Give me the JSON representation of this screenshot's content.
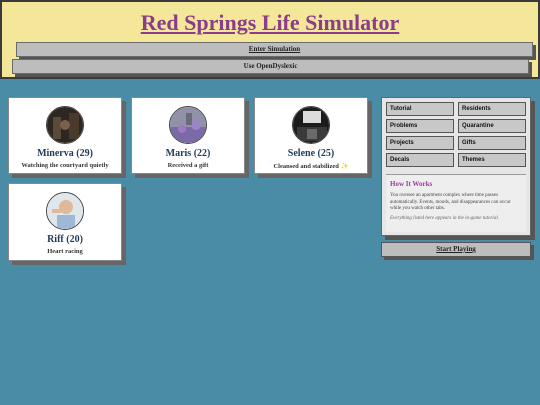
{
  "header": {
    "title": "Red Springs Life Simulator",
    "enter_button": "Enter Simulation",
    "dyslexic_button": "Use OpenDyslexic"
  },
  "residents": [
    {
      "name": "Minerva (29)",
      "status": "Watching the courtyard quietly",
      "avatar": "portrait-dark-room"
    },
    {
      "name": "Maris (22)",
      "status": "Received a gift",
      "avatar": "portrait-lavender-field"
    },
    {
      "name": "Selene (25)",
      "status": "Cleansed and stabilized ✨",
      "avatar": "portrait-dim-hall"
    },
    {
      "name": "Riff (20)",
      "status": "Heart racing",
      "avatar": "portrait-person-gesturing"
    }
  ],
  "panel": {
    "tabs": [
      "Tutorial",
      "Residents",
      "Problems",
      "Quarantine",
      "Projects",
      "Gifts",
      "Decals",
      "Themes"
    ],
    "how_title": "How It Works",
    "how_text": "You oversee an apartment complex where time passes automatically. Events, moods, and disappearances can occur while you watch other tabs.",
    "how_note": "Everything listed here appears in the in-game tutorial."
  },
  "start_button": "Start Playing",
  "colors": {
    "background": "#4a8ca6",
    "header": "#f4e79a",
    "title": "#8a3d8a",
    "name": "#1f3a5a"
  }
}
